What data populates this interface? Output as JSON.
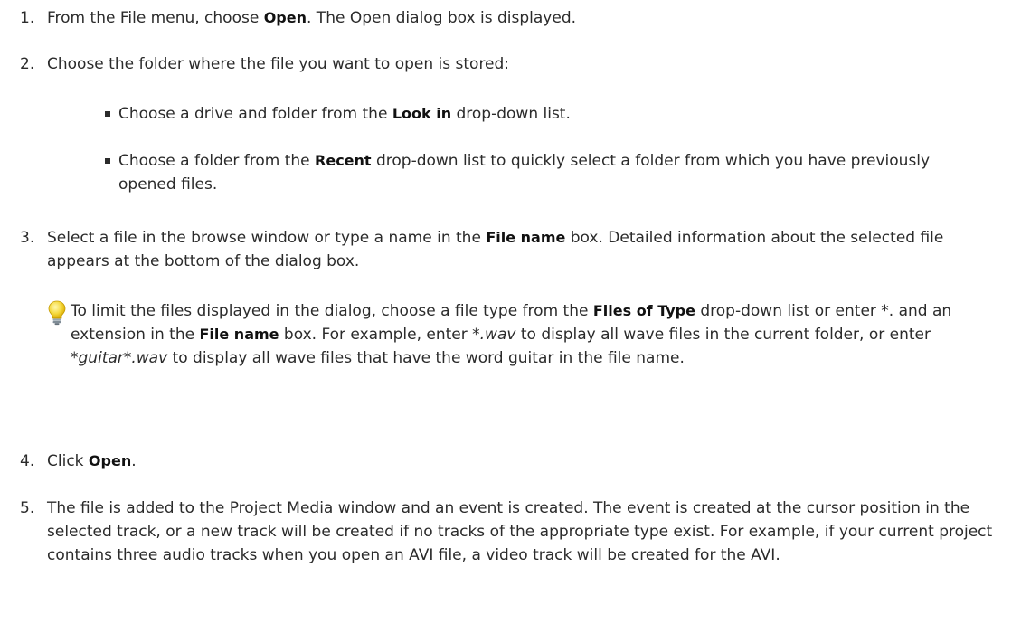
{
  "steps": [
    {
      "number": "1.",
      "parts": [
        "From the File menu, choose ",
        "Open",
        ". The Open dialog box is displayed."
      ]
    },
    {
      "number": "2.",
      "parts": [
        "Choose the folder where the file you want to open is stored:"
      ],
      "bullets": [
        [
          "Choose a drive and folder from the ",
          "Look in",
          " drop-down list."
        ],
        [
          "Choose a folder from the ",
          "Recent",
          " drop-down list to quickly select a folder from which you have previously opened files."
        ]
      ]
    },
    {
      "number": "3.",
      "parts": [
        "Select a file in the browse window or type a name in the ",
        "File name",
        " box. Detailed information about the selected file appears at the bottom of the dialog box."
      ],
      "tip": {
        "icon": "lightbulb-icon",
        "parts": [
          "To limit the files displayed in the dialog, choose a file type from the ",
          "Files of Type",
          " drop-down list or enter *. and an extension in the ",
          "File name",
          " box. For example, enter ",
          "*.wav",
          " to display all wave files in the current folder, or enter ",
          "*guitar*.wav",
          " to display all wave files that have the word guitar in the file name."
        ]
      }
    },
    {
      "number": "4.",
      "parts": [
        "Click ",
        "Open",
        "."
      ]
    },
    {
      "number": "5.",
      "parts": [
        "The file is added to the Project Media window and an event is created. The event is created at the cursor position in the selected track, or a new track will be created if no tracks of the appropriate type exist. For example, if your current project contains three audio tracks when you open an AVI file, a video track will be created for the AVI."
      ]
    }
  ]
}
